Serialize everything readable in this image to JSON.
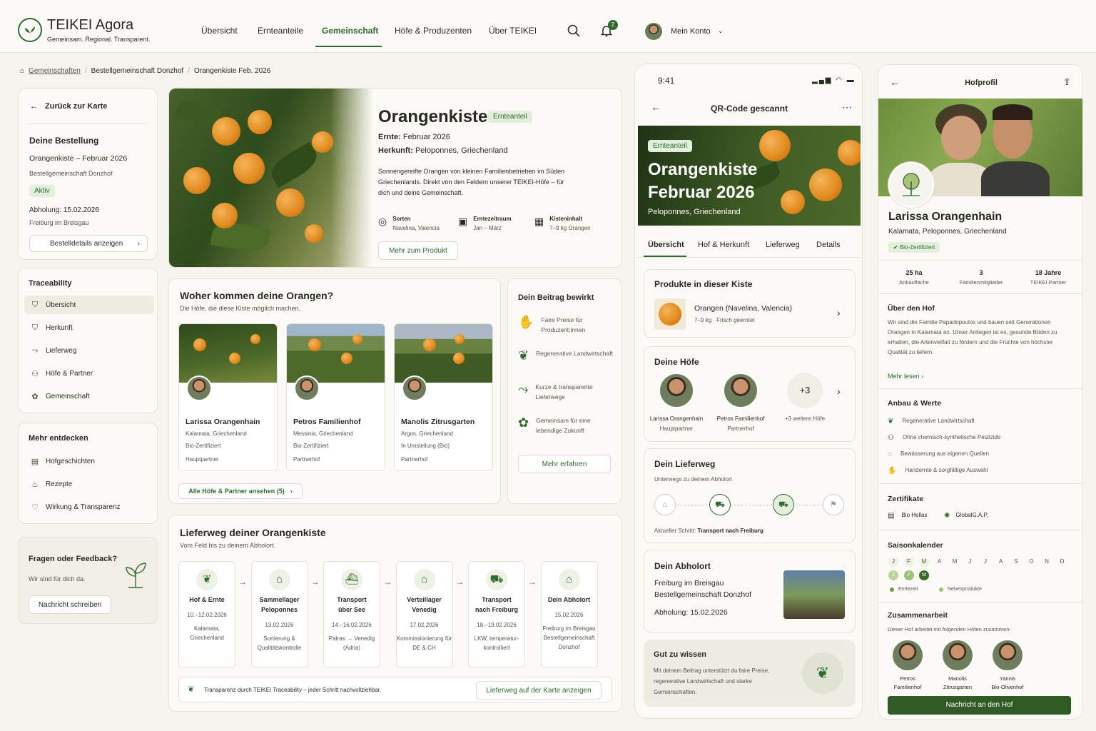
{
  "brand": {
    "name": "TEIKEI Agora",
    "tagline": "Gemeinsam. Regional. Transparent."
  },
  "nav": [
    "Übersicht",
    "Ernteanteile",
    "Gemeinschaft",
    "Höfe & Produzenten",
    "Über TEIKEI"
  ],
  "notifications": "2",
  "account": "Mein Konto",
  "breadcrumb": [
    "Gemeinschaften",
    "Bestellgemeinschaft Donzhof",
    "Orangenkiste Feb. 2026"
  ],
  "sidebar": {
    "back": "Zurück zur Karte",
    "order_title": "Deine Bestellung",
    "order_product": "Orangenkiste – Februar 2026",
    "order_group": "Bestellgemeinschaft Donzhof",
    "order_status": "Aktiv",
    "pickup": "Abholung: 15.02.2026",
    "pickup_place": "Freiburg im Breisgau",
    "details_btn": "Bestelldetails anzeigen",
    "trace_title": "Traceability",
    "trace_items": [
      "Übersicht",
      "Herkunft",
      "Lieferweg",
      "Höfe & Partner",
      "Gemeinschaft"
    ],
    "more_title": "Mehr entdecken",
    "more_items": [
      "Hofgeschichten",
      "Rezepte",
      "Wirkung & Transparenz"
    ],
    "feedback_title": "Fragen oder Feedback?",
    "feedback_text": "Wir sind für dich da.",
    "feedback_btn": "Nachricht schreiben"
  },
  "product": {
    "title": "Orangenkiste",
    "badge": "Ernteanteil",
    "harvest_label": "Ernte:",
    "harvest": "Februar 2026",
    "origin_label": "Herkunft:",
    "origin": "Peloponnes, Griechenland",
    "desc": "Sonnengereifte Orangen von kleinen Familienbetrieben im Süden Griechenlands. Direkt von den Feldern unserer TEIKEI-Höfe – für dich und deine Gemeinschaft.",
    "facts": [
      {
        "t": "Sorten",
        "v": "Navelina, Valencia"
      },
      {
        "t": "Erntezeitraum",
        "v": "Jan – März"
      },
      {
        "t": "Kisteninhalt",
        "v": "7–9 kg Orangen"
      }
    ],
    "more_btn": "Mehr zum Produkt"
  },
  "farms_section": {
    "title": "Woher kommen deine Orangen?",
    "subtitle": "Die Höfe, die diese Kiste möglich machen.",
    "farms": [
      {
        "name": "Larissa Orangenhain",
        "place": "Kalamata, Griechenland",
        "cert": "Bio-Zertifiziert",
        "role": "Hauptpartner"
      },
      {
        "name": "Petros Familienhof",
        "place": "Messinia, Griechenland",
        "cert": "Bio-Zertifiziert",
        "role": "Partnerhof"
      },
      {
        "name": "Manolis Zitrusgarten",
        "place": "Argos, Griechenland",
        "cert": "In Umstellung (Bio)",
        "role": "Partnerhof"
      }
    ],
    "all_btn": "Alle Höfe & Partner ansehen (5)"
  },
  "impact": {
    "title": "Dein Beitrag bewirkt",
    "items": [
      "Faire Preise für Produzent:innen",
      "Regenerative Landwirtschaft",
      "Kurze & transparente Lieferwege",
      "Gemeinsam für eine lebendige Zukunft"
    ],
    "btn": "Mehr erfahren"
  },
  "route": {
    "title": "Lieferweg deiner Orangenkiste",
    "subtitle": "Vom Feld bis zu deinem Abholort.",
    "steps": [
      {
        "t1": "Hof & Ernte",
        "t2": "",
        "d": "10.–12.02.2026",
        "s": "Kalamata, Griechenland"
      },
      {
        "t1": "Sammellager",
        "t2": "Peloponnes",
        "d": "13.02.2026",
        "s": "Sortierung & Qualitätskontrolle"
      },
      {
        "t1": "Transport",
        "t2": "über See",
        "d": "14.–16.02.2026",
        "s": "Patras → Venedig (Adria)"
      },
      {
        "t1": "Verteillager",
        "t2": "Venedig",
        "d": "17.02.2026",
        "s": "Kommissionierung für DE & CH"
      },
      {
        "t1": "Transport",
        "t2": "nach Freiburg",
        "d": "18.–19.02.2026",
        "s": "LKW, temperatur-kontrolliert"
      },
      {
        "t1": "Dein Abholort",
        "t2": "",
        "d": "15.02.2026",
        "s": "Freiburg im Breisgau Bestellgemeinschaft Donzhof"
      }
    ],
    "footer": "Transparenz durch TEIKEI Traceability – jeder Schritt nachvollziehbar.",
    "map_btn": "Lieferweg auf der Karte anzeigen"
  },
  "phone": {
    "time": "9:41",
    "title": "QR-Code gescannt",
    "badge": "Ernteanteil",
    "hero_title1": "Orangenkiste",
    "hero_title2": "Februar 2026",
    "hero_place": "Peloponnes, Griechenland",
    "tabs": [
      "Übersicht",
      "Hof & Herkunft",
      "Lieferweg",
      "Details"
    ],
    "products_title": "Produkte in dieser Kiste",
    "product_name": "Orangen (Navelina, Valencia)",
    "product_info": "7–9 kg · Frisch geerntet",
    "farms_title": "Deine Höfe",
    "farms": [
      {
        "n": "Larissa Orangenhain",
        "r": "Hauptpartner"
      },
      {
        "n": "Petros Familienhof",
        "r": "Partnerhof"
      }
    ],
    "more_farms_count": "+3",
    "more_farms": "+3 weitere Höfe",
    "route_title": "Dein Lieferweg",
    "route_sub": "Unterwegs zu deinem Abholort",
    "route_current_label": "Aktueller Schritt:",
    "route_current": "Transport nach Freiburg",
    "pickup_title": "Dein Abholort",
    "pickup_city": "Freiburg im Breisgau",
    "pickup_group": "Bestellgemeinschaft Donzhof",
    "pickup_date": "Abholung: 15.02.2026",
    "good_title": "Gut zu wissen",
    "good_text": "Mit deinem Beitrag unterstützt du faire Preise, regenerative Landwirtschaft und starke Gemeinschaften."
  },
  "farmprofile": {
    "title": "Hofprofil",
    "name": "Larissa Orangenhain",
    "place": "Kalamata, Peloponnes, Griechenland",
    "cert": "Bio-Zertifiziert",
    "stats": [
      {
        "v": "25 ha",
        "l": "Anbaufläche"
      },
      {
        "v": "3",
        "l": "Familienmitglieder"
      },
      {
        "v": "18 Jahre",
        "l": "TEIKEI Partner"
      }
    ],
    "about_title": "Über den Hof",
    "about_text": "Wir sind die Familie Papadopoulos und bauen seit Generationen Orangen in Kalamata an. Unser Anliegen ist es, gesunde Böden zu erhalten, die Artenvielfalt zu fördern und die Früchte von höchster Qualität zu liefern.",
    "read_more": "Mehr lesen",
    "values_title": "Anbau & Werte",
    "values": [
      "Regenerative Landwirtschaft",
      "Ohne chemisch-synthetische Pestizide",
      "Bewässerung aus eigenen Quellen",
      "Handernte & sorgfältige Auswahl"
    ],
    "certs_title": "Zertifikate",
    "certs": [
      "Bio Hellas",
      "GlobalG.A.P."
    ],
    "season_title": "Saisonkalender",
    "months": [
      "J",
      "F",
      "M",
      "A",
      "M",
      "J",
      "J",
      "A",
      "S",
      "O",
      "N",
      "D"
    ],
    "legend": [
      "Erntezeit",
      "Nebenprodukte"
    ],
    "coop_title": "Zusammenarbeit",
    "coop_text": "Dieser Hof arbeitet mit folgenden Höfen zusammen:",
    "coop": [
      [
        "Petros",
        "Familienhof"
      ],
      [
        "Manolis",
        "Zitrusgarten"
      ],
      [
        "Yannis",
        "Bio-Olivenhof"
      ]
    ],
    "msg_btn": "Nachricht an den Hof"
  },
  "colors": {
    "accent": "#2f6b2f",
    "bg": "#f6f4ee",
    "card": "#fbfaf6",
    "orange": "#e08a1e"
  }
}
